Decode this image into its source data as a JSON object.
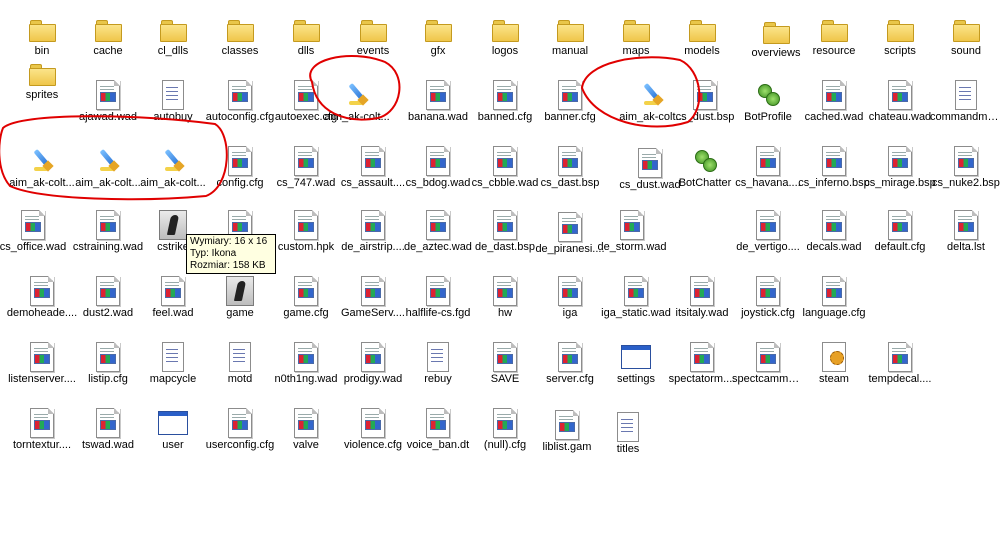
{
  "items": [
    {
      "label": "bin",
      "icon": "folder-icon"
    },
    {
      "label": "cache",
      "icon": "folder-icon"
    },
    {
      "label": "cl_dlls",
      "icon": "folder-icon"
    },
    {
      "label": "classes",
      "icon": "folder-icon"
    },
    {
      "label": "dlls",
      "icon": "folder-icon"
    },
    {
      "label": "events",
      "icon": "folder-icon"
    },
    {
      "label": "gfx",
      "icon": "folder-icon"
    },
    {
      "label": "logos",
      "icon": "folder-icon"
    },
    {
      "label": "manual",
      "icon": "folder-icon"
    },
    {
      "label": "maps",
      "icon": "folder-icon"
    },
    {
      "label": "models",
      "icon": "folder-icon"
    },
    {
      "label": "overviews",
      "icon": "folder-icon"
    },
    {
      "label": "resource",
      "icon": "folder-icon"
    },
    {
      "label": "scripts",
      "icon": "folder-icon"
    },
    {
      "label": "sound",
      "icon": "folder-icon"
    },
    {
      "label": "sprites",
      "icon": "folder-icon"
    },
    {
      "label": "ajawad.wad",
      "icon": "wad-file-icon"
    },
    {
      "label": "autobuy",
      "icon": "text-file-icon"
    },
    {
      "label": "autoconfig.cfg",
      "icon": "wad-file-icon"
    },
    {
      "label": "autoexec.cfg",
      "icon": "wad-file-icon"
    },
    {
      "label": "aim_ak-colt...",
      "icon": "paintbrush-icon"
    },
    {
      "label": "banana.wad",
      "icon": "wad-file-icon"
    },
    {
      "label": "banned.cfg",
      "icon": "wad-file-icon"
    },
    {
      "label": "banner.cfg",
      "icon": "wad-file-icon"
    },
    {
      "label": "aim_ak-colt...",
      "icon": "paintbrush-icon"
    },
    {
      "label": "cs_dust.bsp",
      "icon": "wad-file-icon"
    },
    {
      "label": "BotProfile",
      "icon": "bot-gears-icon"
    },
    {
      "label": "cached.wad",
      "icon": "wad-file-icon"
    },
    {
      "label": "chateau.wad",
      "icon": "wad-file-icon"
    },
    {
      "label": "commandmenu",
      "icon": "text-file-icon"
    },
    {
      "label": "aim_ak-colt...",
      "icon": "paintbrush-icon"
    },
    {
      "label": "aim_ak-colt...",
      "icon": "paintbrush-icon"
    },
    {
      "label": "aim_ak-colt...",
      "icon": "paintbrush-icon"
    },
    {
      "label": "config.cfg",
      "icon": "wad-file-icon"
    },
    {
      "label": "cs_747.wad",
      "icon": "wad-file-icon"
    },
    {
      "label": "cs_assault....",
      "icon": "wad-file-icon"
    },
    {
      "label": "cs_bdog.wad",
      "icon": "wad-file-icon"
    },
    {
      "label": "cs_cbble.wad",
      "icon": "wad-file-icon"
    },
    {
      "label": "cs_dast.bsp",
      "icon": "wad-file-icon"
    },
    {
      "label": "cs_dust.wad",
      "icon": "wad-file-icon"
    },
    {
      "label": "BotChatter",
      "icon": "bot-gears-icon"
    },
    {
      "label": "cs_havana....",
      "icon": "wad-file-icon"
    },
    {
      "label": "cs_inferno.bsp",
      "icon": "wad-file-icon"
    },
    {
      "label": "cs_mirage.bsp",
      "icon": "wad-file-icon"
    },
    {
      "label": "cs_nuke2.bsp",
      "icon": "wad-file-icon"
    },
    {
      "label": "cs_office.wad",
      "icon": "wad-file-icon"
    },
    {
      "label": "cstraining.wad",
      "icon": "wad-file-icon"
    },
    {
      "label": "cstrike",
      "icon": "counter-strike-icon"
    },
    {
      "label": "",
      "icon": "wad-file-icon"
    },
    {
      "label": "custom.hpk",
      "icon": "wad-file-icon"
    },
    {
      "label": "de_airstrip....",
      "icon": "wad-file-icon"
    },
    {
      "label": "de_aztec.wad",
      "icon": "wad-file-icon"
    },
    {
      "label": "de_dast.bsp",
      "icon": "wad-file-icon"
    },
    {
      "label": "de_piranesi....",
      "icon": "wad-file-icon"
    },
    {
      "label": "de_storm.wad",
      "icon": "wad-file-icon"
    },
    {
      "label": "de_vertigo....",
      "icon": "wad-file-icon"
    },
    {
      "label": "decals.wad",
      "icon": "wad-file-icon"
    },
    {
      "label": "default.cfg",
      "icon": "wad-file-icon"
    },
    {
      "label": "delta.lst",
      "icon": "wad-file-icon"
    },
    {
      "label": "demoheade....",
      "icon": "wad-file-icon"
    },
    {
      "label": "dust2.wad",
      "icon": "wad-file-icon"
    },
    {
      "label": "feel.wad",
      "icon": "wad-file-icon"
    },
    {
      "label": "game",
      "icon": "counter-strike-icon"
    },
    {
      "label": "game.cfg",
      "icon": "wad-file-icon"
    },
    {
      "label": "GameServ....",
      "icon": "wad-file-icon"
    },
    {
      "label": "halflife-cs.fgd",
      "icon": "wad-file-icon"
    },
    {
      "label": "hw",
      "icon": "wad-file-icon"
    },
    {
      "label": "iga",
      "icon": "wad-file-icon"
    },
    {
      "label": "iga_static.wad",
      "icon": "wad-file-icon"
    },
    {
      "label": "itsitaly.wad",
      "icon": "wad-file-icon"
    },
    {
      "label": "joystick.cfg",
      "icon": "wad-file-icon"
    },
    {
      "label": "language.cfg",
      "icon": "wad-file-icon"
    },
    {
      "label": "listenserver....",
      "icon": "wad-file-icon"
    },
    {
      "label": "listip.cfg",
      "icon": "wad-file-icon"
    },
    {
      "label": "mapcycle",
      "icon": "text-file-icon"
    },
    {
      "label": "motd",
      "icon": "text-file-icon"
    },
    {
      "label": "n0th1ng.wad",
      "icon": "wad-file-icon"
    },
    {
      "label": "prodigy.wad",
      "icon": "wad-file-icon"
    },
    {
      "label": "rebuy",
      "icon": "text-file-icon"
    },
    {
      "label": "SAVE",
      "icon": "wad-file-icon"
    },
    {
      "label": "server.cfg",
      "icon": "wad-file-icon"
    },
    {
      "label": "settings",
      "icon": "window-icon"
    },
    {
      "label": "spectatorm....",
      "icon": "wad-file-icon"
    },
    {
      "label": "spectcammenu",
      "icon": "wad-file-icon"
    },
    {
      "label": "steam",
      "icon": "steam-gear-icon"
    },
    {
      "label": "tempdecal....",
      "icon": "wad-file-icon"
    },
    {
      "label": "torntextur....",
      "icon": "wad-file-icon"
    },
    {
      "label": "tswad.wad",
      "icon": "wad-file-icon"
    },
    {
      "label": "user",
      "icon": "window-icon"
    },
    {
      "label": "userconfig.cfg",
      "icon": "wad-file-icon"
    },
    {
      "label": "valve",
      "icon": "wad-file-icon"
    },
    {
      "label": "violence.cfg",
      "icon": "wad-file-icon"
    },
    {
      "label": "voice_ban.dt",
      "icon": "wad-file-icon"
    },
    {
      "label": "(null).cfg",
      "icon": "wad-file-icon"
    },
    {
      "label": "liblist.gam",
      "icon": "wad-file-icon"
    },
    {
      "label": "titles",
      "icon": "text-file-icon"
    }
  ],
  "tooltip": {
    "dimensions": "Wymiary: 16 x 16",
    "type": "Typ: Ikona",
    "size": "Rozmiar: 158 KB"
  },
  "colors": {
    "annotation": "#e00000",
    "folder": "#f2cf5b",
    "tooltip_bg": "#ffffe1"
  }
}
